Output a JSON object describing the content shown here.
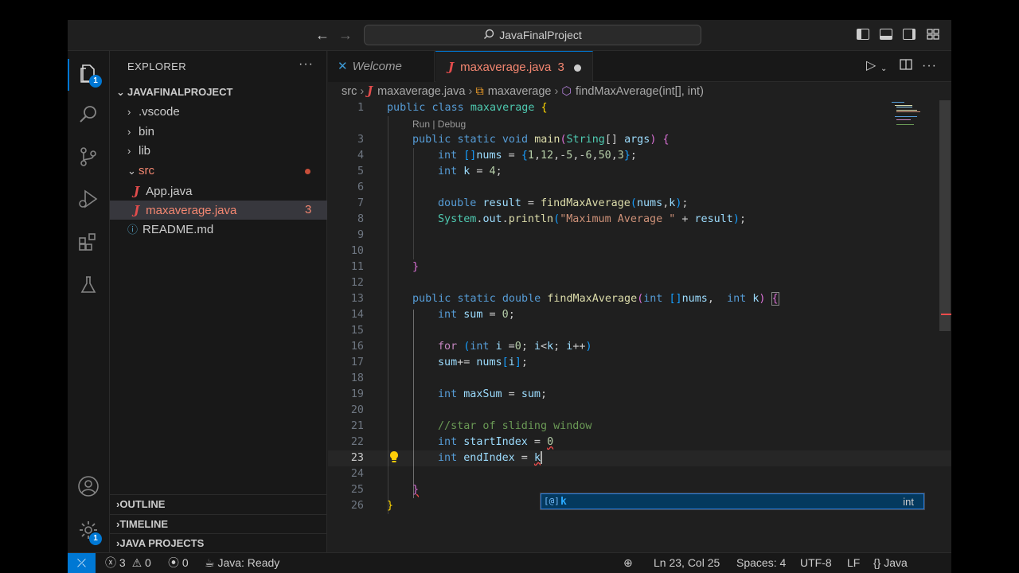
{
  "window": {
    "title": "JavaFinalProject"
  },
  "activity": {
    "explorer_badge": "1",
    "manage_badge": "1"
  },
  "sidebar": {
    "title": "EXPLORER",
    "more": "···",
    "project": "JAVAFINALPROJECT",
    "tree": [
      {
        "label": ".vscode",
        "type": "folder",
        "open": false
      },
      {
        "label": "bin",
        "type": "folder",
        "open": false
      },
      {
        "label": "lib",
        "type": "folder",
        "open": false
      },
      {
        "label": "src",
        "type": "folder",
        "open": true
      },
      {
        "label": "App.java",
        "type": "java"
      },
      {
        "label": "maxaverage.java",
        "type": "java",
        "problems": "3"
      },
      {
        "label": "README.md",
        "type": "md"
      }
    ],
    "sections": [
      "OUTLINE",
      "TIMELINE",
      "JAVA PROJECTS"
    ]
  },
  "tabs": [
    {
      "label": "Welcome"
    },
    {
      "label": "maxaverage.java",
      "problems": "3"
    }
  ],
  "breadcrumb": {
    "folder": "src",
    "file": "maxaverage.java",
    "class": "maxaverage",
    "method": "findMaxAverage(int[], int)"
  },
  "editor": {
    "codelens": "Run | Debug",
    "line_numbers": [
      "1",
      "3",
      "4",
      "5",
      "6",
      "7",
      "8",
      "9",
      "10",
      "11",
      "12",
      "13",
      "14",
      "15",
      "16",
      "17",
      "18",
      "19",
      "20",
      "21",
      "22",
      "23",
      "24",
      "25",
      "26"
    ],
    "suggestion": {
      "label": "k",
      "detail": "int",
      "symbol": "[@]"
    }
  },
  "statusbar": {
    "errors": "3",
    "warnings": "0",
    "ports": "0",
    "java_status": "Java: Ready",
    "position": "Ln 23, Col 25",
    "spaces": "Spaces: 4",
    "encoding": "UTF-8",
    "eol": "LF",
    "language": "Java"
  },
  "colors": {
    "accent": "#0078d4",
    "error": "#f48771",
    "background": "#1f1f1f"
  }
}
